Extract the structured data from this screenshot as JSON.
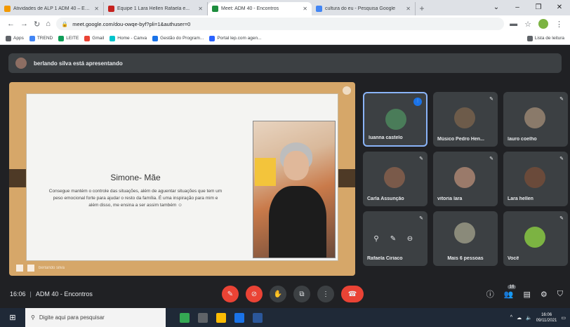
{
  "browser": {
    "tabs": [
      {
        "title": "Atividades de ALP 1 ADM 40 – Ensino...",
        "color": "#f29900",
        "active": false
      },
      {
        "title": "Equipe 1 Lara Hellen Rafaela e...",
        "color": "#c5221f",
        "active": false
      },
      {
        "title": "Meet: ADM 40 - Encontros",
        "color": "#1e8e3e",
        "active": true
      },
      {
        "title": "cultura do eu - Pesquisa Google",
        "color": "#4285f4",
        "active": false
      }
    ],
    "new_tab": "+",
    "url": "meet.google.com/dou-owqe-byf?pli=1&authuser=0",
    "bookmarks": [
      "Apps",
      "TREND",
      "LEITE",
      "Gmail",
      "Home - Canva",
      "Gestão do Program...",
      "Portal lep.com agen..."
    ],
    "reading_list": "Lista de leitura"
  },
  "meet": {
    "presenting_text": "berlando silva está apresentando",
    "slide": {
      "title": "Simone- Mãe",
      "body": "Consegue mantém o controle das situações, além de aguentar situações que tem um peso emocional forte para ajudar o resto da família. É uma inspiração para mim e além disso, me ensina a ser assim também ☺"
    },
    "stage_footer_name": "berlando silva",
    "participants": [
      {
        "name": "luanna castelo",
        "avatar_color": "#4a7c59",
        "speaking": true,
        "selected": true
      },
      {
        "name": "Músico Pedro Hen...",
        "avatar_color": "#6d5b4a",
        "speaking": false,
        "selected": false
      },
      {
        "name": "lauro coelho",
        "avatar_color": "#8a7a6a",
        "speaking": false,
        "selected": false
      },
      {
        "name": "Carla Assunção",
        "avatar_color": "#7a5a4a",
        "speaking": false,
        "selected": false
      },
      {
        "name": "vitoria lara",
        "avatar_color": "#9a7a6a",
        "speaking": false,
        "selected": false
      },
      {
        "name": "Lara hellen",
        "avatar_color": "#6a4a3a",
        "speaking": false,
        "selected": false
      },
      {
        "name": "Rafaela Ciriaco",
        "avatar_color": "",
        "speaking": false,
        "selected": false
      },
      {
        "name": "Mais 6 pessoas",
        "avatar_color": "#8a8a7a",
        "speaking": false,
        "selected": false
      },
      {
        "name": "Você",
        "avatar_color": "#7cb342",
        "speaking": false,
        "selected": false
      }
    ],
    "time": "16:06",
    "meeting_name": "ADM 40 - Encontros",
    "participant_count": "16"
  },
  "taskbar": {
    "search_placeholder": "Digite aqui para pesquisar",
    "clock_time": "16:06",
    "clock_date": "09/11/2021"
  }
}
